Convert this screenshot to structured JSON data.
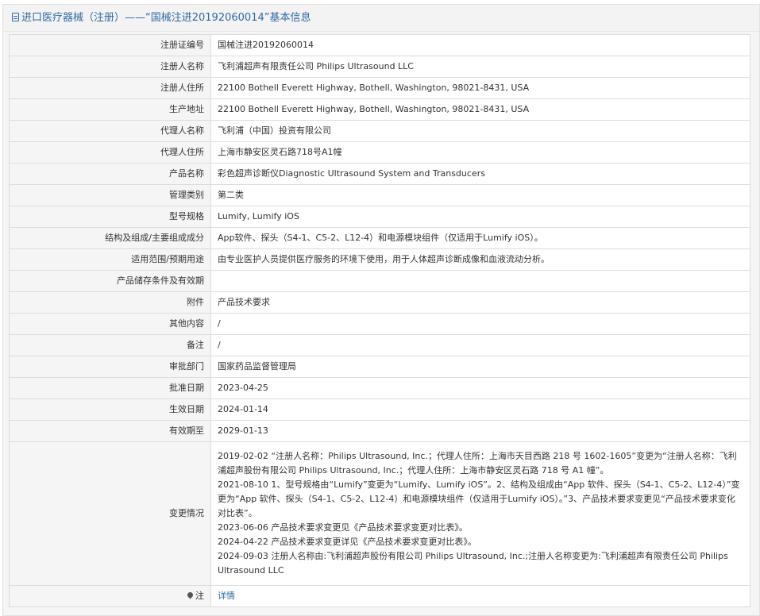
{
  "header": {
    "icon": "document-icon",
    "title": "进口医疗器械（注册）——“国械注进20192060014”基本信息"
  },
  "rows": [
    {
      "key": "注册证编号",
      "value": "国械注进20192060014"
    },
    {
      "key": "注册人名称",
      "value": "飞利浦超声有限责任公司 Philips Ultrasound LLC"
    },
    {
      "key": "注册人住所",
      "value": "22100 Bothell Everett Highway, Bothell, Washington, 98021-8431, USA"
    },
    {
      "key": "生产地址",
      "value": "22100 Bothell Everett Highway, Bothell, Washington, 98021-8431, USA"
    },
    {
      "key": "代理人名称",
      "value": "飞利浦（中国）投资有限公司"
    },
    {
      "key": "代理人住所",
      "value": "上海市静安区灵石路718号A1幢"
    },
    {
      "key": "产品名称",
      "value": "彩色超声诊断仪Diagnostic Ultrasound System and Transducers"
    },
    {
      "key": "管理类别",
      "value": "第二类"
    },
    {
      "key": "型号规格",
      "value": "Lumify, Lumify iOS"
    },
    {
      "key": "结构及组成/主要组成成分",
      "value": "App软件、探头（S4-1、C5-2、L12-4）和电源模块组件（仅适用于Lumify iOS）。"
    },
    {
      "key": "适用范围/预期用途",
      "value": "由专业医护人员提供医疗服务的环境下使用，用于人体超声诊断成像和血液流动分析。"
    },
    {
      "key": "产品储存条件及有效期",
      "value": ""
    },
    {
      "key": "附件",
      "value": "产品技术要求"
    },
    {
      "key": "其他内容",
      "value": "/"
    },
    {
      "key": "备注",
      "value": "/"
    },
    {
      "key": "审批部门",
      "value": "国家药品监督管理局"
    },
    {
      "key": "批准日期",
      "value": "2023-04-25"
    },
    {
      "key": "生效日期",
      "value": "2024-01-14"
    },
    {
      "key": "有效期至",
      "value": "2029-01-13"
    }
  ],
  "change": {
    "key": "变更情况",
    "lines": [
      "2019-02-02 “注册人名称：Philips Ultrasound, Inc.；代理人住所：上海市天目西路 218 号 1602-1605”变更为“注册人名称：飞利浦超声股份有限公司 Philips Ultrasound, Inc.；代理人住所：上海市静安区灵石路 718 号 A1 幢”。",
      "2021-08-10 1、型号规格由“Lumify”变更为“Lumify、Lumify iOS”。2、结构及组成由“App 软件、探头（S4-1、C5-2、L12-4）”变更为“App 软件、探头（S4-1、C5-2、L12-4）和电源模块组件（仅适用于Lumify iOS）。”3、产品技术要求变更见“产品技术要求变化对比表”。",
      "2023-06-06 产品技术要求变更见《产品技术要求变更对比表》。",
      "2024-04-22 产品技术要求变更详见《产品技术要求变更对比表》。",
      "2024-09-03 注册人名称由:飞利浦超声股份有限公司 Philips Ultrasound, Inc.;注册人名称变更为:飞利浦超声有限责任公司 Philips Ultrasound LLC"
    ]
  },
  "note": {
    "icon": "pin-icon",
    "key": "注",
    "link": "详情"
  }
}
